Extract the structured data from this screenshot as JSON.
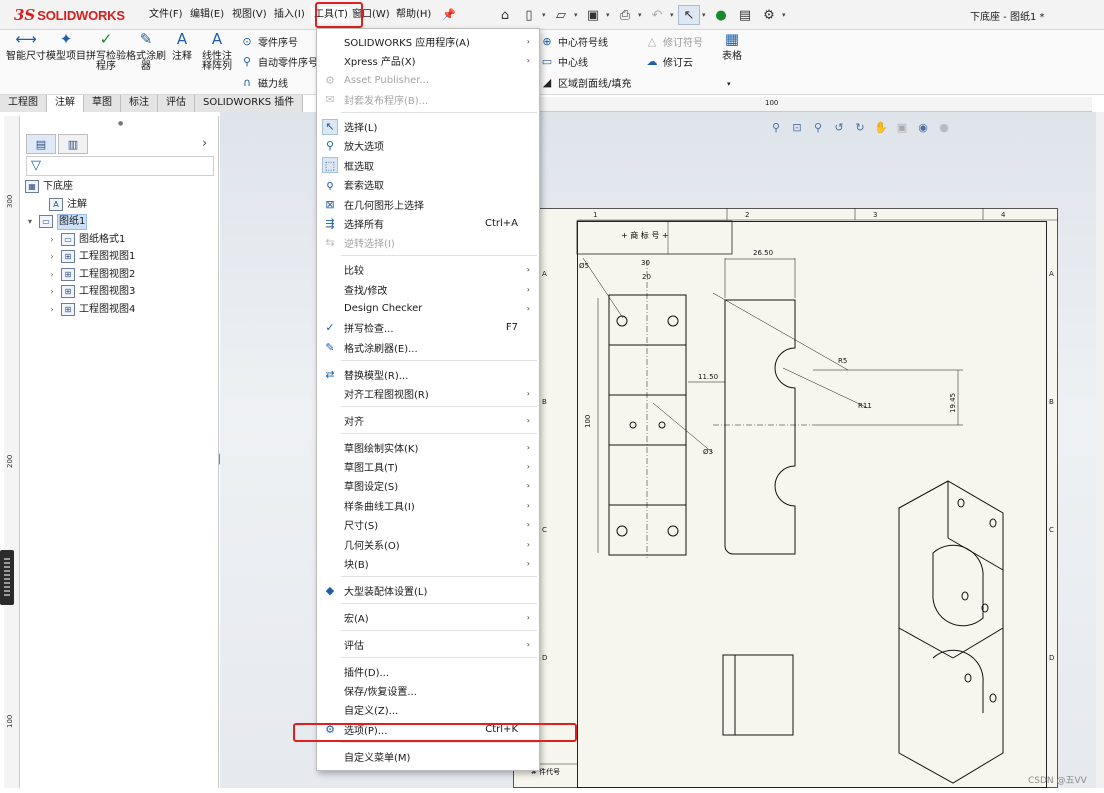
{
  "app": {
    "logo_prefix": "3S",
    "logo_text": "SOLIDWORKS",
    "doc_title": "下底座 - 图纸1 *"
  },
  "menubar": [
    "文件(F)",
    "编辑(E)",
    "视图(V)",
    "插入(I)",
    "工具(T)",
    "窗口(W)",
    "帮助(H)"
  ],
  "ribbon": {
    "big_buttons": [
      "智能尺寸",
      "模型项目",
      "拼写检验程序",
      "格式涂刷器",
      "注释",
      "线性注释阵列"
    ],
    "small_buttons": [
      {
        "label": "零件序号",
        "icon": "balloon-icon",
        "disabled": false
      },
      {
        "label": "自动零件序号",
        "icon": "auto-balloon-icon",
        "disabled": false
      },
      {
        "label": "磁力线",
        "icon": "magnet-icon",
        "disabled": false
      },
      {
        "label": "中心符号线",
        "icon": "center-mark-icon",
        "disabled": false
      },
      {
        "label": "中心线",
        "icon": "centerline-icon",
        "disabled": false
      },
      {
        "label": "区域剖面线/填充",
        "icon": "hatch-icon",
        "disabled": false
      },
      {
        "label": "修订符号",
        "icon": "revision-symbol-icon",
        "disabled": true
      },
      {
        "label": "修订云",
        "icon": "revision-cloud-icon",
        "disabled": false
      }
    ],
    "table_label": "表格"
  },
  "tabs": [
    "工程图",
    "注解",
    "草图",
    "标注",
    "评估",
    "SOLIDWORKS 插件"
  ],
  "active_tab": "注解",
  "feature_tree": [
    {
      "label": "下底座",
      "icon": "drawing-icon",
      "level": 0,
      "expander": ""
    },
    {
      "label": "注解",
      "icon": "annotations-icon",
      "level": 1,
      "expander": ""
    },
    {
      "label": "图纸1",
      "icon": "sheet-icon",
      "level": 0,
      "expander": "▾",
      "selected": true
    },
    {
      "label": "图纸格式1",
      "icon": "sheet-format-icon",
      "level": 2,
      "expander": "›"
    },
    {
      "label": "工程图视图1",
      "icon": "drawing-view-icon",
      "level": 2,
      "expander": "›"
    },
    {
      "label": "工程图视图2",
      "icon": "drawing-view-icon",
      "level": 2,
      "expander": "›"
    },
    {
      "label": "工程图视图3",
      "icon": "drawing-view-icon",
      "level": 2,
      "expander": "›"
    },
    {
      "label": "工程图视图4",
      "icon": "drawing-view-icon",
      "level": 2,
      "expander": "›"
    }
  ],
  "rulers": {
    "vertical": [
      "300",
      "200",
      "100"
    ],
    "horizontal": [
      "100"
    ]
  },
  "sheet_zones": {
    "cols": [
      "1",
      "2",
      "3",
      "4"
    ],
    "rows": [
      "A",
      "B",
      "C",
      "D"
    ]
  },
  "drawing_labels": {
    "title_cell": "+ 商 标 号 +",
    "bottom_left": "# 件代号",
    "dims": [
      "Ø5",
      "30",
      "20",
      "26.50",
      "R5",
      "11.50",
      "R11",
      "19.45",
      "100",
      "Ø3"
    ]
  },
  "tools_menu": [
    {
      "label": "SOLIDWORKS 应用程序(A)",
      "submenu": true
    },
    {
      "label": "Xpress 产品(X)",
      "submenu": true
    },
    {
      "label": "Asset Publisher...",
      "icon": "asset-publisher-icon",
      "disabled": true
    },
    {
      "label": "封套发布程序(B)...",
      "icon": "envelope-publisher-icon",
      "disabled": true
    },
    {
      "sep": true
    },
    {
      "label": "选择(L)",
      "icon": "select-icon",
      "highlight": true
    },
    {
      "label": "放大选项",
      "icon": "magnify-select-icon"
    },
    {
      "label": "框选取",
      "icon": "box-select-icon",
      "highlight": true
    },
    {
      "label": "套索选取",
      "icon": "lasso-select-icon"
    },
    {
      "label": "在几何图形上选择",
      "icon": "select-over-geometry-icon"
    },
    {
      "label": "选择所有",
      "icon": "select-all-icon",
      "shortcut": "Ctrl+A"
    },
    {
      "label": "逆转选择(I)",
      "icon": "invert-selection-icon",
      "disabled": true
    },
    {
      "sep": true
    },
    {
      "label": "比较",
      "submenu": true
    },
    {
      "label": "查找/修改",
      "submenu": true
    },
    {
      "label": "Design Checker",
      "submenu": true
    },
    {
      "label": "拼写检查...",
      "icon": "spell-check-icon",
      "shortcut": "F7"
    },
    {
      "label": "格式涂刷器(E)...",
      "icon": "format-painter-icon"
    },
    {
      "sep": true
    },
    {
      "label": "替换模型(R)...",
      "icon": "replace-model-icon"
    },
    {
      "label": "对齐工程图视图(R)",
      "submenu": true
    },
    {
      "sep": true
    },
    {
      "label": "对齐",
      "submenu": true
    },
    {
      "sep": true
    },
    {
      "label": "草图绘制实体(K)",
      "submenu": true
    },
    {
      "label": "草图工具(T)",
      "submenu": true
    },
    {
      "label": "草图设定(S)",
      "submenu": true
    },
    {
      "label": "样条曲线工具(I)",
      "submenu": true
    },
    {
      "label": "尺寸(S)",
      "submenu": true
    },
    {
      "label": "几何关系(O)",
      "submenu": true
    },
    {
      "label": "块(B)",
      "submenu": true
    },
    {
      "sep": true
    },
    {
      "label": "大型装配体设置(L)",
      "icon": "large-assembly-icon"
    },
    {
      "sep": true
    },
    {
      "label": "宏(A)",
      "submenu": true
    },
    {
      "sep": true
    },
    {
      "label": "评估",
      "submenu": true
    },
    {
      "sep": true
    },
    {
      "label": "插件(D)..."
    },
    {
      "label": "保存/恢复设置..."
    },
    {
      "label": "自定义(Z)..."
    },
    {
      "label": "选项(P)...",
      "icon": "gear-icon",
      "shortcut": "Ctrl+K"
    },
    {
      "sep": true
    },
    {
      "label": "自定义菜单(M)"
    }
  ],
  "colors": {
    "accent_red": "#e02020",
    "brand_red": "#d81e1e",
    "selection_blue": "#cde0f7"
  },
  "watermark": "CSDN @五VV"
}
